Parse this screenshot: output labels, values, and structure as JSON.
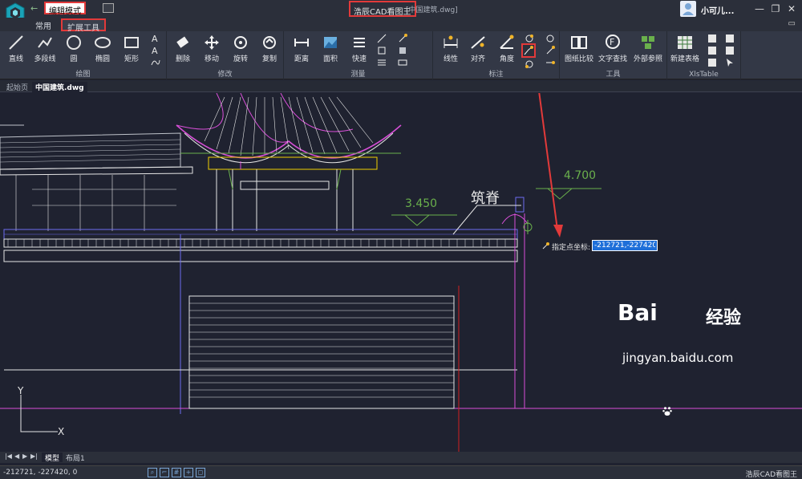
{
  "titlebar": {
    "mode": "编辑模式",
    "app_title": "浩辰CAD看图王",
    "file": "[中国建筑.dwg]",
    "user": "小可儿..."
  },
  "tabs": [
    {
      "label": "常用"
    },
    {
      "label": "扩展工具"
    }
  ],
  "ribbon": {
    "draw": {
      "label": "绘图",
      "tools": [
        "直线",
        "多段线",
        "圆",
        "椭圆",
        "矩形"
      ]
    },
    "modify": {
      "label": "修改",
      "tools": [
        "删除",
        "移动",
        "旋转",
        "复制"
      ]
    },
    "measure": {
      "label": "测量",
      "tools": [
        "距离",
        "面积",
        "快速"
      ]
    },
    "annotate": {
      "label": "标注",
      "tools": [
        "线性",
        "对齐",
        "角度"
      ]
    },
    "tools": {
      "label": "工具",
      "tools": [
        "图纸比较",
        "文字查找",
        "外部参照"
      ]
    },
    "xls": {
      "label": "XlsTable",
      "tools": [
        "新建表格"
      ]
    }
  },
  "doc_tabs": [
    "起始页",
    "中国建筑.dwg"
  ],
  "drawing": {
    "elev1": "3.450",
    "elev2": "4.700",
    "ridge_label": "筑脊",
    "axis_y": "Y",
    "axis_x": "X"
  },
  "prompt": {
    "label": "指定点坐标:",
    "value": "-212721,-227420"
  },
  "layout_tabs": [
    "模型",
    "布局1"
  ],
  "status": {
    "coords": "-212721, -227420, 0",
    "app": "浩辰CAD看图王"
  },
  "watermark": {
    "brand": "Bai",
    "brand2": "经验",
    "site": "jingyan.baidu.com"
  }
}
